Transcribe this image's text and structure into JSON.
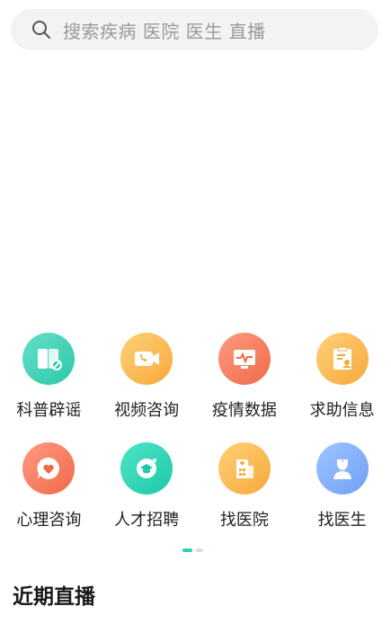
{
  "search": {
    "placeholder": "搜索疾病 医院 医生 直播",
    "icon": "search-icon"
  },
  "services": [
    {
      "label": "科普辟谣",
      "icon": "book-icon",
      "color_from": "#66dfc9",
      "color_to": "#2cc8a9"
    },
    {
      "label": "视频咨询",
      "icon": "video-call-icon",
      "color_from": "#ffd179",
      "color_to": "#f7a83a"
    },
    {
      "label": "疫情数据",
      "icon": "monitor-pulse-icon",
      "color_from": "#ff9a80",
      "color_to": "#f0694a"
    },
    {
      "label": "求助信息",
      "icon": "clipboard-user-icon",
      "color_from": "#ffd179",
      "color_to": "#f7a83a"
    },
    {
      "label": "心理咨询",
      "icon": "heart-chat-icon",
      "color_from": "#ff9a80",
      "color_to": "#f0694a"
    },
    {
      "label": "人才招聘",
      "icon": "graduate-icon",
      "color_from": "#4fe3c8",
      "color_to": "#1cc9a6"
    },
    {
      "label": "找医院",
      "icon": "hospital-icon",
      "color_from": "#ffd179",
      "color_to": "#f7a83a"
    },
    {
      "label": "找医生",
      "icon": "doctor-icon",
      "color_from": "#9fc4ff",
      "color_to": "#6fa1f5"
    }
  ],
  "pager": {
    "active_index": 0,
    "count": 2,
    "active_color": "#2dd1b6"
  },
  "section": {
    "title": "近期直播"
  }
}
